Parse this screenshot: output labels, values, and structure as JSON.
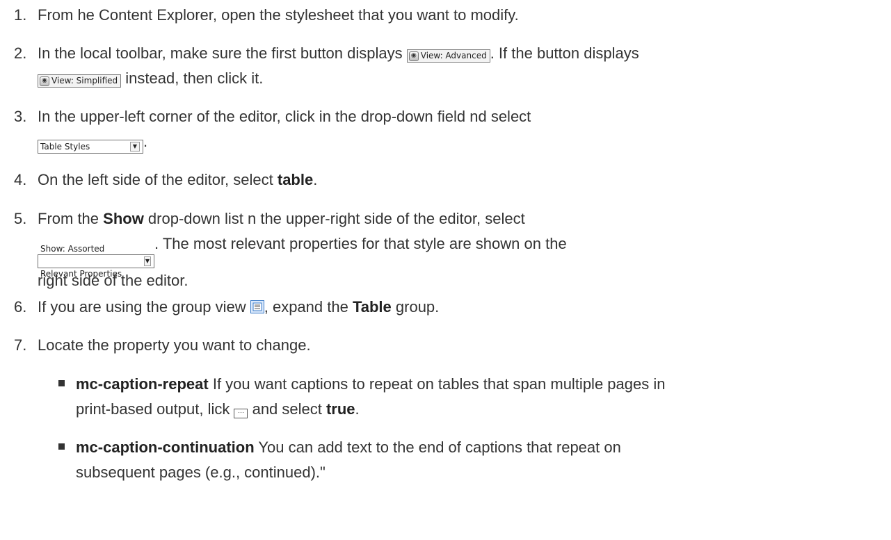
{
  "steps": [
    {
      "num": "1.",
      "text": "From  he Content Explorer, open the stylesheet that you want to modify."
    },
    {
      "num": "2.",
      "a": "In the local toolbar, make sure the first button displays",
      "btn1": "View: Advanced",
      "b": ". If the button displays",
      "btn2": "View: Simplified",
      "c": " instead, then click it."
    },
    {
      "num": "3.",
      "a": "In the upper-left corner of the editor, click in the drop-down field  nd select",
      "select": "Table Styles",
      "b": "."
    },
    {
      "num": "4.",
      "a": "On the left side of the editor, select ",
      "bold": "table",
      "b": "."
    },
    {
      "num": "5.",
      "a": "From the ",
      "bold": "Show",
      "b": " drop-down list  n the upper-right side of the editor, select",
      "select": "Show: Assorted Relevant Properties",
      "c": ". The most relevant properties for that style are shown on the",
      "d": "right side of the editor."
    },
    {
      "num": "6.",
      "a": "If you are using the group view ",
      "b": ", expand the ",
      "bold": "Table",
      "c": " group."
    },
    {
      "num": "7.",
      "text": "Locate the property you want to change."
    }
  ],
  "bullets": [
    {
      "bold": "mc-caption-repeat",
      "a": " If you want captions to repeat on tables that span multiple pages in",
      "b": "print-based output,  lick ",
      "c": " and select ",
      "bold2": "true",
      "d": "."
    },
    {
      "bold": "mc-caption-continuation",
      "a": " You can add text to the end of captions that repeat on",
      "b": "subsequent pages (e.g., continued).\""
    }
  ],
  "icons": {
    "view_button": "eye-icon",
    "dropdown_arrow": "chevron-down-icon",
    "group_view": "group-view-icon",
    "ellipsis": "ellipsis-icon"
  }
}
